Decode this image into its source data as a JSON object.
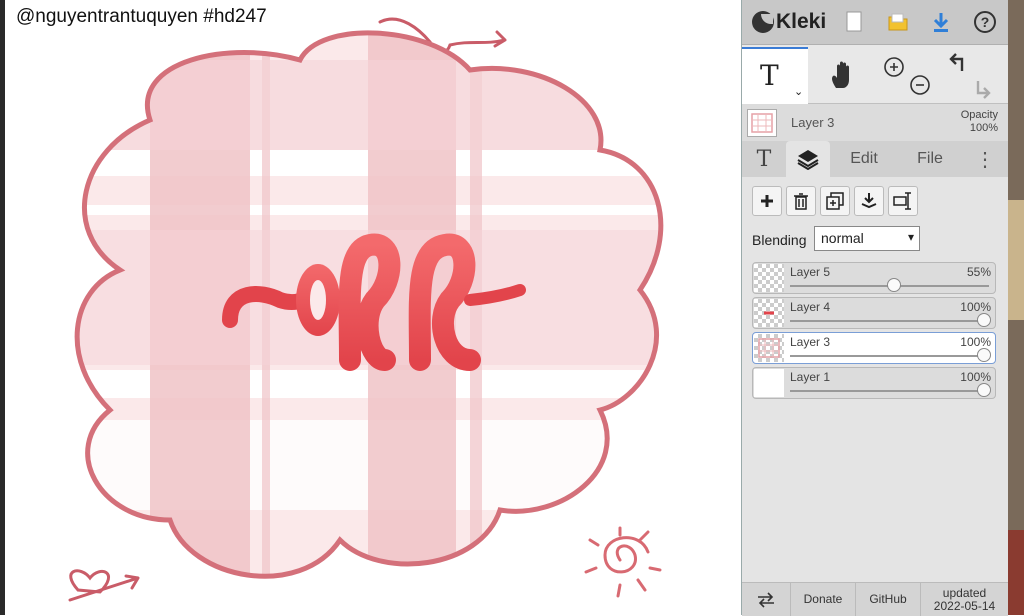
{
  "canvas": {
    "watermark": "@nguyentrantuquyen #hd247",
    "artwork_text": "off"
  },
  "topbar": {
    "logo": "Kleki",
    "new_icon": "new-file-icon",
    "open_icon": "open-folder-icon",
    "save_icon": "download-icon",
    "help_icon": "help-icon"
  },
  "tools": {
    "active_tool": "text-tool",
    "items": [
      "text-tool",
      "hand-tool",
      "zoom-in-icon",
      "zoom-out-icon",
      "undo-icon",
      "redo-icon"
    ]
  },
  "layer_strip": {
    "name": "Layer 3",
    "opacity_label": "Opacity",
    "opacity_value": "100%"
  },
  "tabs": {
    "text": "T",
    "edit": "Edit",
    "file": "File",
    "more": "⋮"
  },
  "layers_panel": {
    "blending_label": "Blending",
    "blending_value": "normal",
    "layers": [
      {
        "name": "Layer 5",
        "opacity": "55%",
        "value": 0.55
      },
      {
        "name": "Layer 4",
        "opacity": "100%",
        "value": 1.0
      },
      {
        "name": "Layer 3",
        "opacity": "100%",
        "value": 1.0,
        "active": true
      },
      {
        "name": "Layer 1",
        "opacity": "100%",
        "value": 1.0
      }
    ]
  },
  "footer": {
    "swap_icon": "swap-arrows-icon",
    "donate": "Donate",
    "github": "GitHub",
    "updated_label": "updated",
    "updated_date": "2022-05-14"
  },
  "colors": {
    "accent": "#3a7bd5",
    "plaid_pink": "#f2c9cc",
    "outline": "#d4707a",
    "lettering": "#f05a5e"
  }
}
